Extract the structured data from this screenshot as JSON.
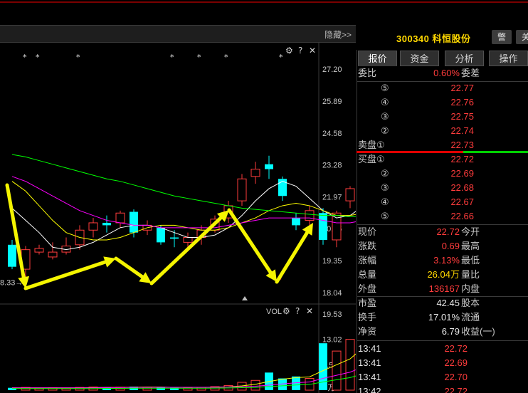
{
  "hide_label": "隐藏>>",
  "stock": {
    "code": "300340",
    "name": "科恒股份",
    "display": "300340 科恒股份",
    "btn_alert": "警",
    "btn_more": "关"
  },
  "tabs": [
    {
      "label": "报价",
      "active": true
    },
    {
      "label": "资金",
      "active": false
    },
    {
      "label": "分析",
      "active": false
    },
    {
      "label": "操作",
      "active": false
    }
  ],
  "chart_controls": {
    "gear": "⚙",
    "help": "?",
    "close": "✕",
    "vol_label": "VOL"
  },
  "price_axis": [
    "27.20",
    "25.89",
    "24.58",
    "23.28",
    "21.97",
    "20.66",
    "19.35",
    "18.04"
  ],
  "volume_axis": [
    "19.53",
    "13.02",
    "6.51",
    "X万"
  ],
  "low_marker": "8.33→",
  "committee": {
    "ratio_label": "委比",
    "ratio_value": "0.60%",
    "diff_label": "委差"
  },
  "sell_orders": [
    {
      "label": "⑤",
      "price": "22.77"
    },
    {
      "label": "④",
      "price": "22.76"
    },
    {
      "label": "③",
      "price": "22.75"
    },
    {
      "label": "②",
      "price": "22.74"
    },
    {
      "label": "卖盘①",
      "price": "22.73"
    }
  ],
  "buy_orders": [
    {
      "label": "买盘①",
      "price": "22.72"
    },
    {
      "label": "②",
      "price": "22.69"
    },
    {
      "label": "③",
      "price": "22.68"
    },
    {
      "label": "④",
      "price": "22.67"
    },
    {
      "label": "⑤",
      "price": "22.66"
    }
  ],
  "stats": [
    {
      "label": "现价",
      "value": "22.72",
      "color": "red",
      "label2": "今开"
    },
    {
      "label": "涨跌",
      "value": "0.69",
      "color": "red",
      "label2": "最高"
    },
    {
      "label": "涨幅",
      "value": "3.13%",
      "color": "red",
      "label2": "最低"
    },
    {
      "label": "总量",
      "value": "26.04万",
      "color": "yellow",
      "label2": "量比"
    },
    {
      "label": "外盘",
      "value": "136167",
      "color": "red",
      "label2": "内盘"
    }
  ],
  "fundamentals": [
    {
      "label": "市盈",
      "value": "42.45",
      "label2": "股本"
    },
    {
      "label": "换手",
      "value": "17.01%",
      "label2": "流通"
    },
    {
      "label": "净资",
      "value": "6.79",
      "label2": "收益(一)"
    }
  ],
  "ticks": [
    {
      "time": "13:41",
      "price": "22.72"
    },
    {
      "time": "13:41",
      "price": "22.69"
    },
    {
      "time": "13:41",
      "price": "22.70"
    },
    {
      "time": "13:42",
      "price": "22.72"
    }
  ],
  "colors": {
    "up": "#ff3c3c",
    "down": "#00ffff",
    "accent": "#ffd800",
    "ma5": "#ffffff",
    "ma10": "#ffff00",
    "ma20": "#ff00ff",
    "ma60": "#00ff00",
    "arrow": "#f5f500"
  },
  "candles": [
    {
      "o": 20.0,
      "c": 19.1,
      "h": 20.2,
      "l": 19.0
    },
    {
      "o": 19.0,
      "c": 19.8,
      "h": 19.95,
      "l": 18.4
    },
    {
      "o": 19.7,
      "c": 19.85,
      "h": 20.0,
      "l": 19.6
    },
    {
      "o": 19.5,
      "c": 19.7,
      "h": 20.1,
      "l": 19.4
    },
    {
      "o": 19.7,
      "c": 19.95,
      "h": 20.3,
      "l": 19.6
    },
    {
      "o": 20.0,
      "c": 20.6,
      "h": 20.8,
      "l": 19.8
    },
    {
      "o": 20.6,
      "c": 20.9,
      "h": 21.1,
      "l": 20.3
    },
    {
      "o": 20.9,
      "c": 20.8,
      "h": 21.2,
      "l": 20.5
    },
    {
      "o": 20.9,
      "c": 21.3,
      "h": 21.4,
      "l": 20.7
    },
    {
      "o": 21.35,
      "c": 20.5,
      "h": 21.45,
      "l": 20.3
    },
    {
      "o": 20.6,
      "c": 20.8,
      "h": 21.0,
      "l": 20.4
    },
    {
      "o": 20.7,
      "c": 20.1,
      "h": 20.8,
      "l": 20.0
    },
    {
      "o": 20.3,
      "c": 20.25,
      "h": 20.6,
      "l": 19.9
    },
    {
      "o": 20.1,
      "c": 20.3,
      "h": 20.5,
      "l": 19.8
    },
    {
      "o": 20.3,
      "c": 20.6,
      "h": 20.8,
      "l": 20.0
    },
    {
      "o": 20.6,
      "c": 21.05,
      "h": 21.2,
      "l": 20.5
    },
    {
      "o": 21.1,
      "c": 21.6,
      "h": 21.8,
      "l": 20.9
    },
    {
      "o": 21.8,
      "c": 22.7,
      "h": 22.9,
      "l": 21.6
    },
    {
      "o": 22.8,
      "c": 23.1,
      "h": 23.4,
      "l": 22.5
    },
    {
      "o": 23.3,
      "c": 23.1,
      "h": 23.65,
      "l": 22.7
    },
    {
      "o": 22.7,
      "c": 22.0,
      "h": 22.8,
      "l": 21.8
    },
    {
      "o": 21.1,
      "c": 20.8,
      "h": 21.3,
      "l": 20.6
    },
    {
      "o": 21.0,
      "c": 21.4,
      "h": 21.6,
      "l": 20.8
    },
    {
      "o": 21.3,
      "c": 20.2,
      "h": 21.5,
      "l": 20.0
    },
    {
      "o": 20.2,
      "c": 21.3,
      "h": 21.4,
      "l": 19.9
    },
    {
      "o": 21.8,
      "c": 22.3,
      "h": 22.4,
      "l": 21.5
    },
    {
      "o": 22.3,
      "c": 22.72,
      "h": 23.2,
      "l": 22.1
    }
  ],
  "volumes": [
    0.6,
    0.7,
    0.5,
    0.6,
    0.55,
    0.7,
    0.8,
    0.7,
    0.75,
    0.9,
    0.7,
    0.75,
    0.6,
    0.55,
    0.7,
    0.9,
    1.2,
    2.0,
    2.5,
    4.5,
    3.0,
    3.5,
    3.0,
    12.0,
    10.0,
    13.0,
    15.5
  ],
  "ma": {
    "ma5": [
      21.5,
      21.0,
      20.5,
      19.9,
      19.8,
      19.9,
      20.1,
      20.4,
      20.7,
      20.8,
      20.8,
      20.7,
      20.5,
      20.3,
      20.3,
      20.4,
      20.7,
      21.2,
      21.8,
      22.3,
      22.6,
      22.4,
      21.9,
      21.4,
      21.1,
      21.2,
      21.6
    ],
    "ma10": [
      22.6,
      22.2,
      21.6,
      21.0,
      20.5,
      20.3,
      20.2,
      20.2,
      20.3,
      20.5,
      20.7,
      20.8,
      20.8,
      20.7,
      20.6,
      20.6,
      20.7,
      20.9,
      21.1,
      21.4,
      21.6,
      21.7,
      21.6,
      21.4,
      21.2,
      21.2,
      21.3
    ],
    "ma20": [
      22.8,
      22.6,
      22.3,
      22.0,
      21.7,
      21.4,
      21.2,
      21.0,
      20.9,
      20.8,
      20.8,
      20.7,
      20.7,
      20.7,
      20.7,
      20.7,
      20.8,
      20.9,
      21.0,
      21.1,
      21.1,
      21.1,
      21.1,
      21.0,
      20.9,
      20.9,
      21.0
    ],
    "ma60": [
      23.7,
      23.6,
      23.45,
      23.3,
      23.15,
      23.0,
      22.85,
      22.7,
      22.6,
      22.45,
      22.3,
      22.15,
      22.0,
      21.9,
      21.8,
      21.7,
      21.6,
      21.5,
      21.45,
      21.4,
      21.35,
      21.3,
      21.25,
      21.2,
      21.2,
      21.15,
      21.15
    ]
  },
  "vol_ma": {
    "ma5": [
      0.6,
      0.6,
      0.6,
      0.6,
      0.6,
      0.6,
      0.65,
      0.7,
      0.7,
      0.75,
      0.8,
      0.8,
      0.7,
      0.7,
      0.7,
      0.75,
      0.85,
      1.1,
      1.5,
      2.2,
      2.8,
      3.2,
      3.4,
      5.0,
      6.5,
      8.0,
      11.0
    ],
    "ma10": [
      0.6,
      0.6,
      0.6,
      0.6,
      0.6,
      0.6,
      0.6,
      0.65,
      0.65,
      0.7,
      0.7,
      0.72,
      0.72,
      0.72,
      0.72,
      0.75,
      0.8,
      0.9,
      1.0,
      1.3,
      1.6,
      1.9,
      2.1,
      3.0,
      3.8,
      4.6,
      6.0
    ]
  }
}
